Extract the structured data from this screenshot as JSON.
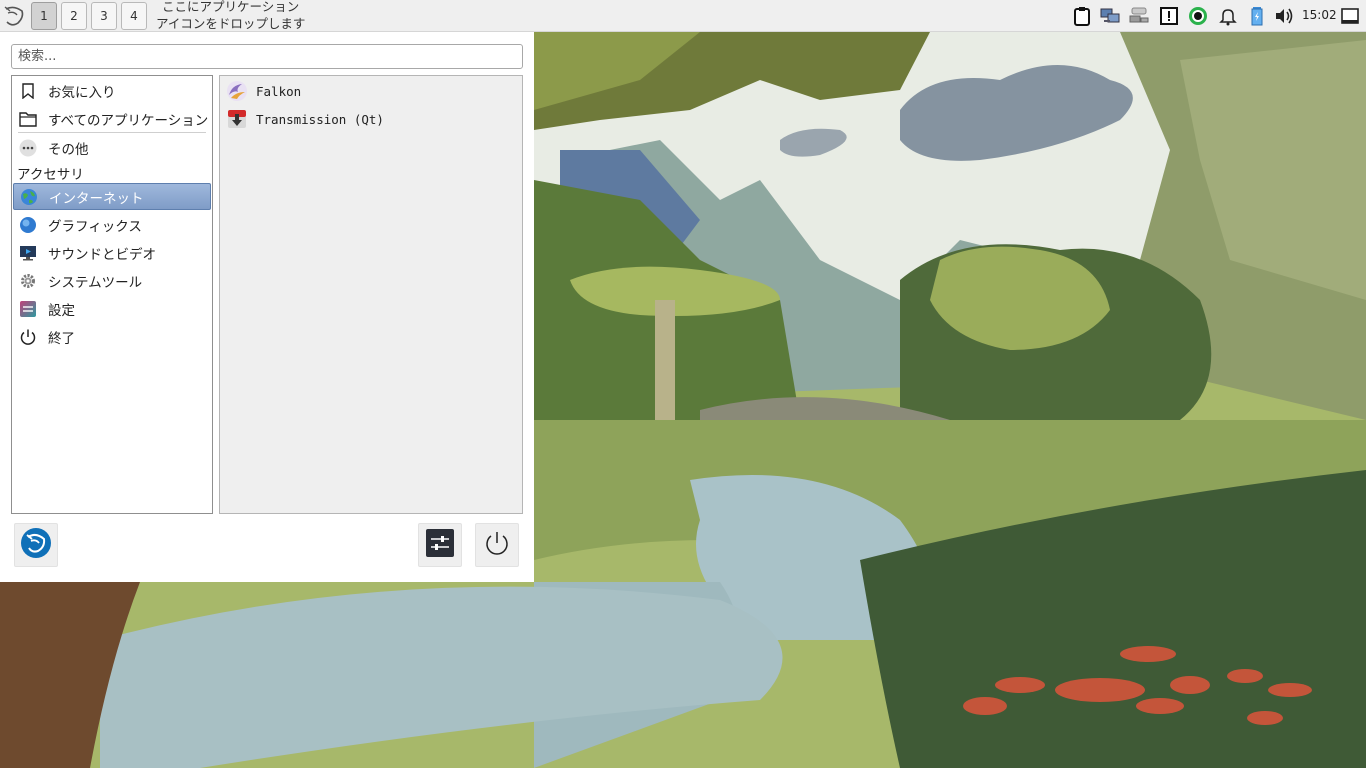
{
  "panel": {
    "desktops": [
      "1",
      "2",
      "3",
      "4"
    ],
    "active_desktop": "1",
    "drop_hint_line1": "ここにアプリケーション",
    "drop_hint_line2": "アイコンをドロップします",
    "tray_icons": [
      "clipboard-icon",
      "network-icon",
      "network-wired-icon",
      "notice-icon",
      "record-icon",
      "bell-icon",
      "battery-icon",
      "volume-icon",
      "show-desktop-icon"
    ],
    "clock": "15:02"
  },
  "menu": {
    "search_placeholder": "検索...",
    "categories": [
      {
        "label": "お気に入り",
        "icon": "bookmark-icon"
      },
      {
        "label": "すべてのアプリケーション",
        "icon": "folder-icon"
      },
      {
        "label": "その他",
        "icon": "more-icon"
      }
    ],
    "section_header": "アクセサリ",
    "groups": [
      {
        "label": "インターネット",
        "icon": "globe-icon",
        "selected": true
      },
      {
        "label": "グラフィックス",
        "icon": "graphics-icon"
      },
      {
        "label": "サウンドとビデオ",
        "icon": "multimedia-icon"
      },
      {
        "label": "システムツール",
        "icon": "gear-icon"
      },
      {
        "label": "設定",
        "icon": "settings-icon"
      },
      {
        "label": "終了",
        "icon": "power-icon"
      }
    ],
    "apps": [
      {
        "label": "Falkon",
        "icon": "falkon-icon"
      },
      {
        "label": "Transmission (Qt)",
        "icon": "transmission-icon"
      }
    ],
    "selected_color": "#7f9cc7"
  }
}
